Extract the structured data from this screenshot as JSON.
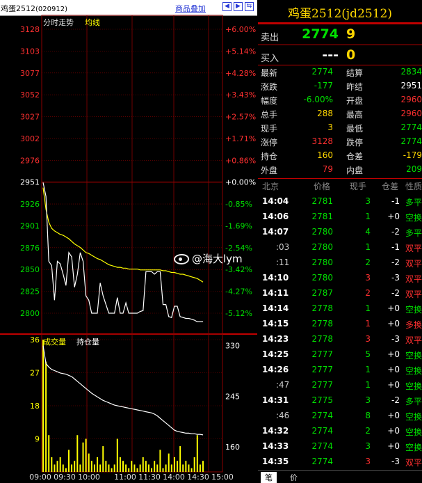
{
  "title_bar": {
    "instrument": "鸡蛋2512",
    "code": "(020912)",
    "overlay_link": "商品叠加",
    "nav_icons": [
      "left-arrow-icon",
      "right-arrow-icon",
      "swap-icon"
    ]
  },
  "chart_labels": {
    "timeshare": "分时走势",
    "avg_line": "均线",
    "volume": "成交量",
    "open_interest": "持仓量"
  },
  "colors": {
    "up": "#ff3030",
    "down": "#00e000",
    "neutral": "#ffffff",
    "price_line": "#ffffff",
    "avg_line": "#ffff00",
    "grid": "#8b0000",
    "volume_bar": "#ffff00"
  },
  "price_axis": {
    "left": [
      "3128",
      "3103",
      "3077",
      "3052",
      "3027",
      "3002",
      "2976",
      "2951",
      "2926",
      "2901",
      "2876",
      "2850",
      "2825",
      "2800"
    ],
    "right": [
      "+6.00%",
      "+5.14%",
      "+4.28%",
      "+3.43%",
      "+2.57%",
      "+1.71%",
      "+0.86%",
      "+0.00%",
      "-0.85%",
      "-1.69%",
      "-2.54%",
      "-3.42%",
      "-4.27%",
      "-5.12%"
    ]
  },
  "volume_axis": {
    "left": [
      "36",
      "27",
      "18",
      "9"
    ],
    "right": [
      "330",
      "245",
      "160"
    ]
  },
  "time_axis": [
    "09:00",
    "09:30",
    "10:00",
    "11:00",
    "11:30",
    "14:00",
    "14:30",
    "15:00"
  ],
  "chart_data": {
    "type": "line",
    "x_ticks": [
      "09:00",
      "09:30",
      "10:00",
      "11:00",
      "11:30",
      "14:00",
      "14:30",
      "15:00"
    ],
    "prev_settle": 2951,
    "ylim": [
      2788,
      3128
    ],
    "series": [
      {
        "name": "price",
        "values": [
          2951,
          2935,
          2860,
          2855,
          2815,
          2860,
          2857,
          2845,
          2832,
          2870,
          2865,
          2830,
          2845,
          2870,
          2860,
          2820,
          2815,
          2800,
          2800,
          2800,
          2835,
          2820,
          2810,
          2800,
          2800,
          2800,
          2818,
          2800,
          2800,
          2812,
          2800,
          2800,
          2800,
          2800,
          2802,
          2803,
          2848,
          2848,
          2848,
          2845,
          2848,
          2848,
          2810,
          2810,
          2796,
          2795,
          2808,
          2808,
          2796,
          2795,
          2794,
          2794,
          2793,
          2792,
          2790,
          2790,
          2790
        ]
      },
      {
        "name": "avg",
        "values": [
          2945,
          2920,
          2905,
          2898,
          2895,
          2893,
          2891,
          2890,
          2888,
          2886,
          2883,
          2880,
          2878,
          2876,
          2873,
          2870,
          2869,
          2867,
          2865,
          2863,
          2862,
          2860,
          2858,
          2856,
          2855,
          2854,
          2853,
          2853,
          2852,
          2852,
          2851,
          2851,
          2851,
          2851,
          2850,
          2850,
          2850,
          2850,
          2850,
          2850,
          2850,
          2850,
          2849,
          2849,
          2848,
          2847,
          2847,
          2846,
          2845,
          2845,
          2844,
          2843,
          2842,
          2841,
          2840,
          2838,
          2836
        ]
      },
      {
        "name": "volume",
        "values": [
          36,
          30,
          10,
          4,
          2,
          3,
          4,
          2,
          1,
          6,
          2,
          3,
          10,
          2,
          8,
          9,
          5,
          3,
          2,
          4,
          2,
          7,
          3,
          2,
          1,
          2,
          9,
          4,
          3,
          2,
          1,
          3,
          2,
          1,
          2,
          4,
          3,
          2,
          1,
          3,
          2,
          6,
          1,
          2,
          5,
          2,
          4,
          3,
          7,
          2,
          3,
          2,
          1,
          4,
          10,
          2,
          3
        ]
      },
      {
        "name": "open_interest",
        "values": [
          330,
          300,
          294,
          290,
          288,
          286,
          284,
          283,
          282,
          280,
          278,
          274,
          270,
          266,
          262,
          258,
          254,
          250,
          247,
          244,
          241,
          238,
          236,
          234,
          232,
          230,
          229,
          228,
          227,
          226,
          225,
          224,
          223,
          222,
          221,
          220,
          219,
          218,
          217,
          215,
          212,
          208,
          204,
          200,
          196,
          192,
          188,
          186,
          185,
          184,
          183,
          183,
          182,
          182,
          181,
          181,
          180
        ]
      }
    ],
    "volume_ylim": [
      0,
      36
    ],
    "oi_ylim": [
      118,
      340
    ]
  },
  "quote": {
    "header": "鸡蛋2512(jd2512)",
    "sell": {
      "label": "卖出",
      "price": "2774",
      "vol": "9"
    },
    "buy": {
      "label": "买入",
      "price": "---",
      "vol": "0"
    },
    "stats": [
      {
        "l1": "最新",
        "v1": "2774",
        "c1": "#00e000",
        "l2": "结算",
        "v2": "2834",
        "c2": "#00e000"
      },
      {
        "l1": "涨跌",
        "v1": "-177",
        "c1": "#00e000",
        "l2": "昨结",
        "v2": "2951",
        "c2": "#ffffff"
      },
      {
        "l1": "幅度",
        "v1": "-6.00%",
        "c1": "#00e000",
        "l2": "开盘",
        "v2": "2960",
        "c2": "#ff3030"
      },
      {
        "l1": "总手",
        "v1": "288",
        "c1": "#ffd700",
        "l2": "最高",
        "v2": "2960",
        "c2": "#ff3030"
      },
      {
        "l1": "现手",
        "v1": "3",
        "c1": "#ffd700",
        "l2": "最低",
        "v2": "2774",
        "c2": "#00e000"
      },
      {
        "l1": "涨停",
        "v1": "3128",
        "c1": "#ff3030",
        "l2": "跌停",
        "v2": "2774",
        "c2": "#00e000"
      },
      {
        "l1": "持仓",
        "v1": "160",
        "c1": "#ffd700",
        "l2": "仓差",
        "v2": "-179",
        "c2": "#ffd700"
      },
      {
        "l1": "外盘",
        "v1": "79",
        "c1": "#ff3030",
        "l2": "内盘",
        "v2": "209",
        "c2": "#00e000"
      }
    ]
  },
  "ticks_header": {
    "time": "北京",
    "price": "价格",
    "vol": "现手",
    "oi": "仓差",
    "nature": "性质"
  },
  "ticks": [
    {
      "time": "14:04",
      "short": false,
      "price": "2781",
      "vol": "3",
      "vc": "#00e000",
      "chg": "-1",
      "nature": "多平",
      "nc": "#00e000"
    },
    {
      "time": "14:06",
      "short": false,
      "price": "2781",
      "vol": "1",
      "vc": "#00e000",
      "chg": "+0",
      "nature": "空换",
      "nc": "#00e000"
    },
    {
      "time": "14:07",
      "short": false,
      "price": "2780",
      "vol": "4",
      "vc": "#00e000",
      "chg": "-2",
      "nature": "多平",
      "nc": "#00e000"
    },
    {
      "time": ":03",
      "short": true,
      "price": "2780",
      "vol": "1",
      "vc": "#00e000",
      "chg": "-1",
      "nature": "双平",
      "nc": "#ff3030"
    },
    {
      "time": ":11",
      "short": true,
      "price": "2780",
      "vol": "2",
      "vc": "#00e000",
      "chg": "-2",
      "nature": "双平",
      "nc": "#ff3030"
    },
    {
      "time": "14:10",
      "short": false,
      "price": "2780",
      "vol": "3",
      "vc": "#ff3030",
      "chg": "-3",
      "nature": "双平",
      "nc": "#ff3030"
    },
    {
      "time": "14:11",
      "short": false,
      "price": "2787",
      "vol": "2",
      "vc": "#ff3030",
      "chg": "-2",
      "nature": "双平",
      "nc": "#ff3030"
    },
    {
      "time": "14:14",
      "short": false,
      "price": "2778",
      "vol": "1",
      "vc": "#00e000",
      "chg": "+0",
      "nature": "空换",
      "nc": "#00e000"
    },
    {
      "time": "14:15",
      "short": false,
      "price": "2778",
      "vol": "1",
      "vc": "#ff3030",
      "chg": "+0",
      "nature": "多换",
      "nc": "#ff3030"
    },
    {
      "time": "14:23",
      "short": false,
      "price": "2778",
      "vol": "3",
      "vc": "#ff3030",
      "chg": "-3",
      "nature": "双平",
      "nc": "#ff3030"
    },
    {
      "time": "14:25",
      "short": false,
      "price": "2777",
      "vol": "5",
      "vc": "#00e000",
      "chg": "+0",
      "nature": "空换",
      "nc": "#00e000"
    },
    {
      "time": "14:26",
      "short": false,
      "price": "2777",
      "vol": "1",
      "vc": "#00e000",
      "chg": "+0",
      "nature": "空换",
      "nc": "#00e000"
    },
    {
      "time": ":47",
      "short": true,
      "price": "2777",
      "vol": "1",
      "vc": "#00e000",
      "chg": "+0",
      "nature": "空换",
      "nc": "#00e000"
    },
    {
      "time": "14:31",
      "short": false,
      "price": "2775",
      "vol": "3",
      "vc": "#00e000",
      "chg": "-2",
      "nature": "多平",
      "nc": "#00e000"
    },
    {
      "time": ":46",
      "short": true,
      "price": "2774",
      "vol": "8",
      "vc": "#00e000",
      "chg": "+0",
      "nature": "空换",
      "nc": "#00e000"
    },
    {
      "time": "14:32",
      "short": false,
      "price": "2774",
      "vol": "2",
      "vc": "#00e000",
      "chg": "+0",
      "nature": "空换",
      "nc": "#00e000"
    },
    {
      "time": "14:33",
      "short": false,
      "price": "2774",
      "vol": "3",
      "vc": "#00e000",
      "chg": "+0",
      "nature": "空换",
      "nc": "#00e000"
    },
    {
      "time": "14:35",
      "short": false,
      "price": "2774",
      "vol": "3",
      "vc": "#ff3030",
      "chg": "-3",
      "nature": "双平",
      "nc": "#ff3030"
    }
  ],
  "footer_tabs": [
    "笔",
    "价"
  ],
  "watermark": "@海大lym"
}
